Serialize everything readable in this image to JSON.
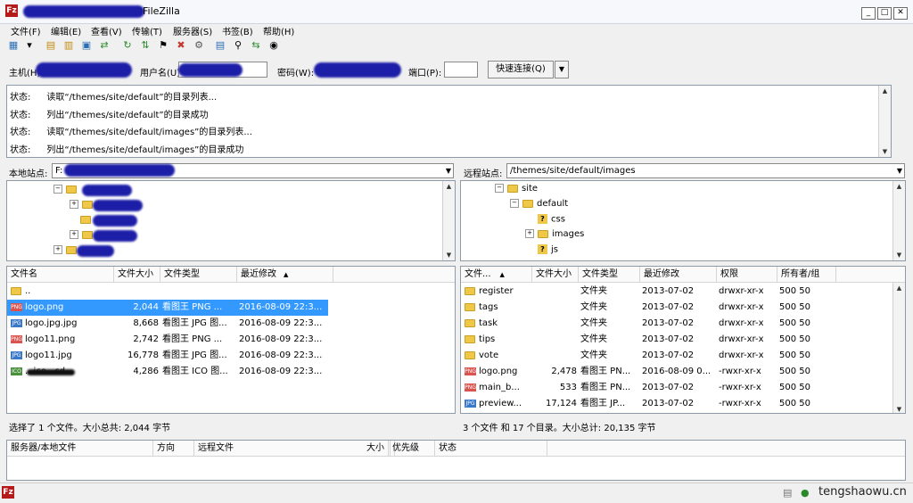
{
  "window": {
    "title": "FileZilla",
    "icon": "filezilla-logo"
  },
  "menu": [
    "文件(F)",
    "编辑(E)",
    "查看(V)",
    "传输(T)",
    "服务器(S)",
    "书签(B)",
    "帮助(H)"
  ],
  "quickconnect": {
    "host_label": "主机(H):",
    "user_label": "用户名(U):",
    "pass_label": "密码(W):",
    "port_label": "端口(P):",
    "connect_button": "快速连接(Q)",
    "dropdown_arrow": "▼"
  },
  "log": [
    {
      "label": "状态:",
      "text": "读取“/themes/site/default”的目录列表..."
    },
    {
      "label": "状态:",
      "text": "列出“/themes/site/default”的目录成功"
    },
    {
      "label": "状态:",
      "text": "读取“/themes/site/default/images”的目录列表..."
    },
    {
      "label": "状态:",
      "text": "列出“/themes/site/default/images”的目录成功"
    }
  ],
  "local": {
    "site_label": "本地站点:",
    "path": "F:",
    "columns": [
      "文件名",
      "文件大小",
      "文件类型",
      "最近修改"
    ],
    "files": [
      {
        "name": "..",
        "size": "",
        "type": "",
        "modified": "",
        "icon": "folder"
      },
      {
        "name": "logo.png",
        "size": "2,044",
        "type": "看图王 PNG ...",
        "modified": "2016-08-09 22:3...",
        "icon": "png",
        "selected": true
      },
      {
        "name": "logo.jpg.jpg",
        "size": "8,668",
        "type": "看图王 JPG 图...",
        "modified": "2016-08-09 22:3...",
        "icon": "jpg"
      },
      {
        "name": "logo11.png",
        "size": "2,742",
        "type": "看图王 PNG ...",
        "modified": "2016-08-09 22:3...",
        "icon": "png"
      },
      {
        "name": "logo11.jpg",
        "size": "16,778",
        "type": "看图王 JPG 图...",
        "modified": "2016-08-09 22:3...",
        "icon": "jpg"
      },
      {
        "name": "...ico...cd...",
        "size": "4,286",
        "type": "看图王 ICO 图...",
        "modified": "2016-08-09 22:3...",
        "icon": "ico"
      }
    ],
    "status": "选择了 1 个文件。大小总共: 2,044 字节"
  },
  "remote": {
    "site_label": "远程站点:",
    "path": "/themes/site/default/images",
    "tree": [
      {
        "name": "site",
        "indent": 0,
        "icon": "folder",
        "expander": "−"
      },
      {
        "name": "default",
        "indent": 1,
        "icon": "folder",
        "expander": "−"
      },
      {
        "name": "css",
        "indent": 2,
        "icon": "question",
        "expander": ""
      },
      {
        "name": "images",
        "indent": 2,
        "icon": "folder",
        "expander": "+"
      },
      {
        "name": "js",
        "indent": 2,
        "icon": "question",
        "expander": ""
      }
    ],
    "columns": [
      "文件...",
      "文件大小",
      "文件类型",
      "最近修改",
      "权限",
      "所有者/组"
    ],
    "files": [
      {
        "name": "register",
        "size": "",
        "type": "文件夹",
        "modified": "2013-07-02",
        "perm": "drwxr-xr-x",
        "owner": "500 50",
        "icon": "folder"
      },
      {
        "name": "tags",
        "size": "",
        "type": "文件夹",
        "modified": "2013-07-02",
        "perm": "drwxr-xr-x",
        "owner": "500 50",
        "icon": "folder"
      },
      {
        "name": "task",
        "size": "",
        "type": "文件夹",
        "modified": "2013-07-02",
        "perm": "drwxr-xr-x",
        "owner": "500 50",
        "icon": "folder"
      },
      {
        "name": "tips",
        "size": "",
        "type": "文件夹",
        "modified": "2013-07-02",
        "perm": "drwxr-xr-x",
        "owner": "500 50",
        "icon": "folder"
      },
      {
        "name": "vote",
        "size": "",
        "type": "文件夹",
        "modified": "2013-07-02",
        "perm": "drwxr-xr-x",
        "owner": "500 50",
        "icon": "folder"
      },
      {
        "name": "logo.png",
        "size": "2,478",
        "type": "看图王 PN...",
        "modified": "2016-08-09 0...",
        "perm": "-rwxr-xr-x",
        "owner": "500 50",
        "icon": "png"
      },
      {
        "name": "main_b...",
        "size": "533",
        "type": "看图王 PN...",
        "modified": "2013-07-02",
        "perm": "-rwxr-xr-x",
        "owner": "500 50",
        "icon": "png"
      },
      {
        "name": "preview...",
        "size": "17,124",
        "type": "看图王 JP...",
        "modified": "2013-07-02",
        "perm": "-rwxr-xr-x",
        "owner": "500 50",
        "icon": "jpg"
      }
    ],
    "status": "3 个文件 和 17 个目录。大小总计: 20,135 字节"
  },
  "queue": {
    "columns": [
      "服务器/本地文件",
      "方向",
      "远程文件",
      "大小",
      "优先级",
      "状态"
    ]
  },
  "watermark": "tengshaowu.cn",
  "colors": {
    "selection": "#3399ff",
    "folder": "#f0c848",
    "png_icon": "#d9534f",
    "jpg_icon": "#3a78c9"
  }
}
